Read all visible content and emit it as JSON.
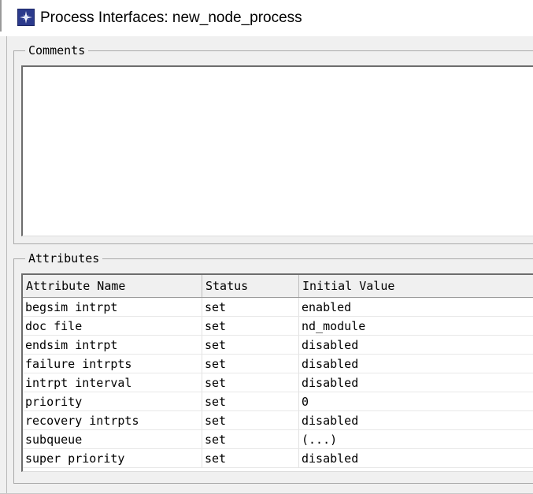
{
  "window": {
    "title": "Process Interfaces: new_node_process",
    "icon": "opnet-star-icon"
  },
  "comments": {
    "legend": "Comments",
    "text": ""
  },
  "attributes": {
    "legend": "Attributes",
    "columns": [
      "Attribute Name",
      "Status",
      "Initial Value"
    ],
    "rows": [
      [
        "begsim intrpt",
        "set",
        "enabled"
      ],
      [
        "doc file",
        "set",
        "nd_module"
      ],
      [
        "endsim intrpt",
        "set",
        "disabled"
      ],
      [
        "failure intrpts",
        "set",
        "disabled"
      ],
      [
        "intrpt interval",
        "set",
        "disabled"
      ],
      [
        "priority",
        "set",
        "0"
      ],
      [
        "recovery intrpts",
        "set",
        "disabled"
      ],
      [
        "subqueue",
        "set",
        "(...)"
      ],
      [
        "super priority",
        "set",
        "disabled"
      ]
    ]
  }
}
